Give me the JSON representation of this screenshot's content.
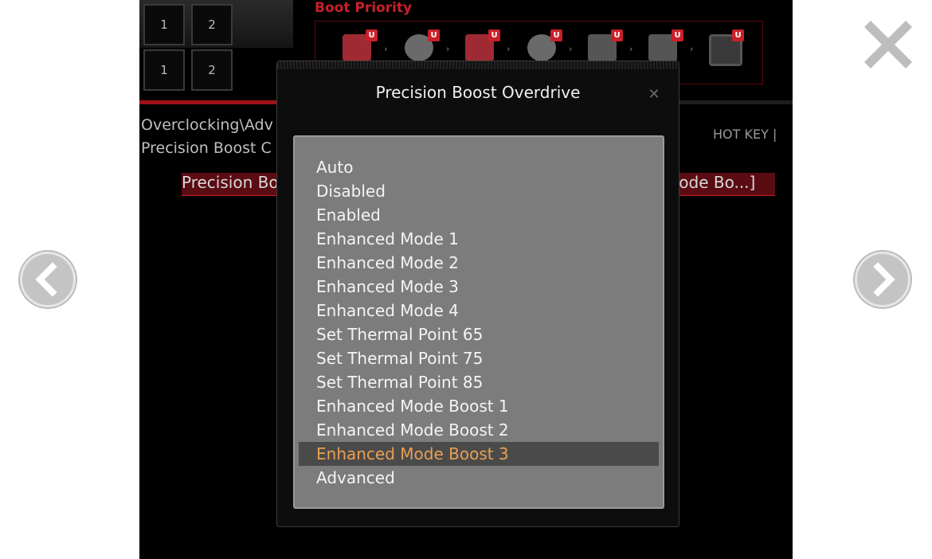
{
  "profiles": {
    "row1": [
      "1",
      "2"
    ],
    "row2": [
      "1",
      "2"
    ]
  },
  "boot_priority": {
    "title": "Boot Priority",
    "badge": "U",
    "devices": [
      "hdd-icon",
      "optical-disc-icon",
      "usb-hdd-icon",
      "usb-cd-icon",
      "usb-key-icon",
      "usb-floppy-icon",
      "network-icon"
    ]
  },
  "breadcrumb": {
    "line1": "Overclocking\\Adv",
    "line2": "Precision Boost C"
  },
  "hotkey": "HOT KEY  |",
  "setting": {
    "label": "Precision Bo",
    "value": "Mode Bo...]"
  },
  "dialog": {
    "title": "Precision Boost Overdrive",
    "close_glyph": "✕",
    "options": [
      "Auto",
      "Disabled",
      "Enabled",
      "Enhanced Mode 1",
      "Enhanced Mode 2",
      "Enhanced Mode 3",
      "Enhanced Mode 4",
      "Set Thermal Point 65",
      "Set Thermal Point 75",
      "Set Thermal Point 85",
      "Enhanced Mode Boost 1",
      "Enhanced Mode Boost 2",
      "Enhanced Mode Boost 3",
      "Advanced"
    ],
    "selected": "Enhanced Mode Boost 3"
  },
  "viewer": {
    "close_icon": "close-icon",
    "prev_icon": "chevron-left-icon",
    "next_icon": "chevron-right-icon"
  },
  "colors": {
    "accent": "#c8202a",
    "selected_text": "#e8a050",
    "list_bg": "#7c7c7c"
  }
}
